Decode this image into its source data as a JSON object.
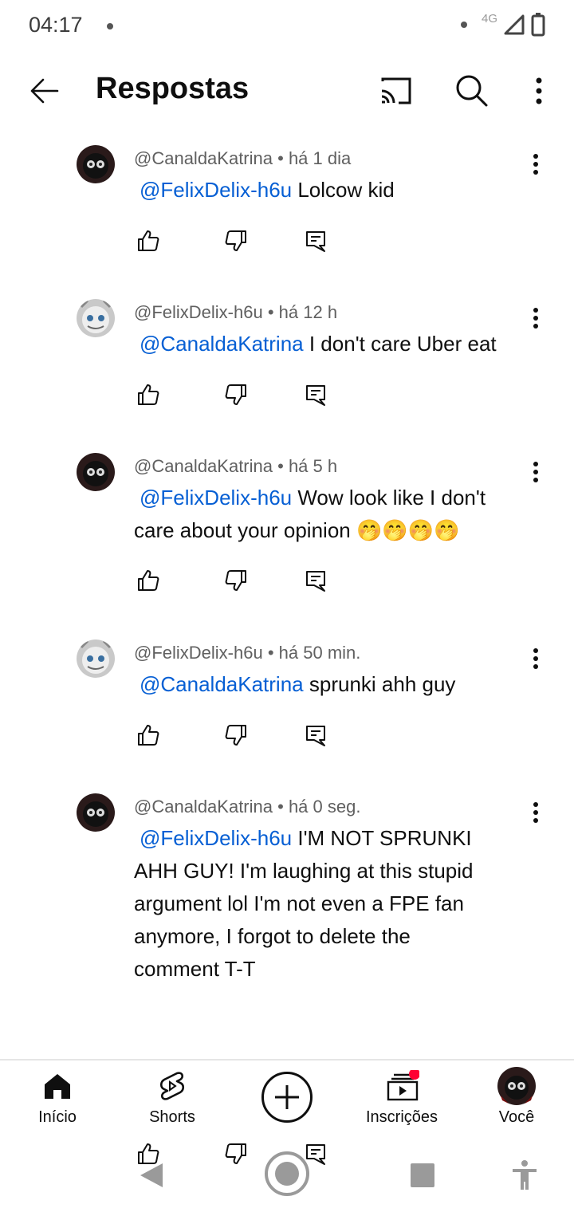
{
  "status_bar": {
    "time": "04:17",
    "network": "4G"
  },
  "header": {
    "title": "Respostas"
  },
  "comments": [
    {
      "author": "@CanaldaKatrina",
      "time": "há 1 dia",
      "mention": "@FelixDelix-h6u",
      "text_lines": [
        " Lolcow kid"
      ],
      "avatar": "dark-character-avatar"
    },
    {
      "author": "@FelixDelix-h6u",
      "time": "há 12 h",
      "mention": "@CanaldaKatrina",
      "text_lines": [
        " I don't care Uber eat"
      ],
      "avatar": "grey-character-avatar"
    },
    {
      "author": "@CanaldaKatrina",
      "time": "há 5 h",
      "mention": "@FelixDelix-h6u",
      "text_lines": [
        "Wow look like I don't",
        "care about your opinion 🤭🤭🤭🤭"
      ],
      "avatar": "dark-character-avatar"
    },
    {
      "author": "@FelixDelix-h6u",
      "time": "há 50 min.",
      "mention": "@CanaldaKatrina",
      "text_lines": [
        " sprunki ahh guy"
      ],
      "avatar": "grey-character-avatar"
    },
    {
      "author": "@CanaldaKatrina",
      "time": "há 0 seg.",
      "mention": "@FelixDelix-h6u",
      "text_lines": [
        " I'M NOT SPRUNKI",
        "AHH GUY! I'm laughing at this stupid",
        "argument lol I'm not even a FPE fan",
        "anymore, I forgot to delete the",
        "comment T-T"
      ],
      "avatar": "dark-character-avatar"
    }
  ],
  "bottom_nav": {
    "items": [
      {
        "label": "Início",
        "icon": "home-icon"
      },
      {
        "label": "Shorts",
        "icon": "shorts-icon"
      },
      {
        "label": "",
        "icon": "create-icon"
      },
      {
        "label": "Inscrições",
        "icon": "subscriptions-icon"
      },
      {
        "label": "Você",
        "icon": "avatar"
      }
    ]
  },
  "colors": {
    "mention": "#065fd4",
    "meta": "#606060",
    "notification": "#ff0033"
  }
}
